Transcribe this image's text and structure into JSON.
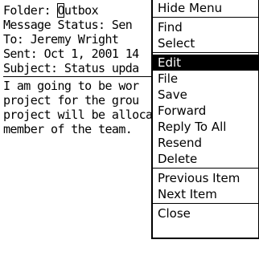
{
  "message": {
    "folder_label": "Folder:",
    "folder_cursor_char": "O",
    "folder_value_rest": "utbox",
    "status_line": "Message Status: Sen",
    "to_line": "To: Jeremy Wright",
    "sent_line": "Sent: Oct 1, 2001 14",
    "subject_line": "Subject: Status upda",
    "body_lines": [
      "I am going to be wor",
      "project for the grou",
      "project will be alloca",
      "member of the team."
    ]
  },
  "menu": {
    "groups": [
      {
        "items": [
          {
            "label": "Hide Menu",
            "selected": false
          }
        ]
      },
      {
        "items": [
          {
            "label": "Find",
            "selected": false
          },
          {
            "label": "Select",
            "selected": false
          }
        ]
      },
      {
        "items": [
          {
            "label": "Edit",
            "selected": true
          },
          {
            "label": "File",
            "selected": false
          },
          {
            "label": "Save",
            "selected": false
          },
          {
            "label": "Forward",
            "selected": false
          },
          {
            "label": "Reply To All",
            "selected": false
          },
          {
            "label": "Resend",
            "selected": false
          },
          {
            "label": "Delete",
            "selected": false
          }
        ]
      },
      {
        "items": [
          {
            "label": "Previous Item",
            "selected": false
          },
          {
            "label": "Next Item",
            "selected": false
          }
        ]
      },
      {
        "items": [
          {
            "label": "Close",
            "selected": false
          }
        ]
      }
    ]
  }
}
